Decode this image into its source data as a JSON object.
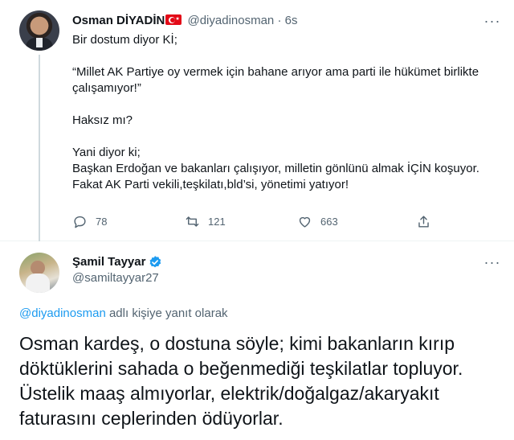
{
  "tweet1": {
    "author_name": "Osman DİYADİN",
    "handle": "@diyadinosman",
    "time": "· 6s",
    "more_label": "···",
    "paragraphs": [
      "Bir dostum diyor Kİ;",
      "“Millet AK Partiye oy vermek için bahane arıyor ama parti ile hükümet birlikte çalışamıyor!”",
      "Haksız mı?",
      "Yani diyor ki;\nBaşkan Erdoğan ve bakanları çalışıyor, milletin gönlünü almak İÇİN koşuyor.\nFakat AK Parti vekili,teşkilatı,bld’si, yönetimi yatıyor!"
    ],
    "actions": {
      "reply_count": "78",
      "retweet_count": "121",
      "like_count": "663"
    }
  },
  "tweet2": {
    "author_name": "Şamil Tayyar",
    "handle": "@samiltayyar27",
    "more_label": "···",
    "reply_to_handle": "@diyadinosman",
    "reply_to_suffix": " adlı kişiye yanıt olarak",
    "text": "Osman kardeş, o dostuna söyle; kimi bakanların kırıp döktüklerini sahada o beğenmediği teşkilatlar topluyor. Üstelik maaş almıyorlar, elektrik/doğalgaz/akaryakıt faturasını ceplerinden ödüyorlar."
  },
  "colors": {
    "accent": "#1d9bf0",
    "secondary_text": "#536471",
    "flag_red": "#e30a17"
  },
  "icons": [
    "reply-icon",
    "retweet-icon",
    "like-icon",
    "share-icon",
    "verified-badge-icon",
    "turkish-flag-icon",
    "more-icon"
  ]
}
